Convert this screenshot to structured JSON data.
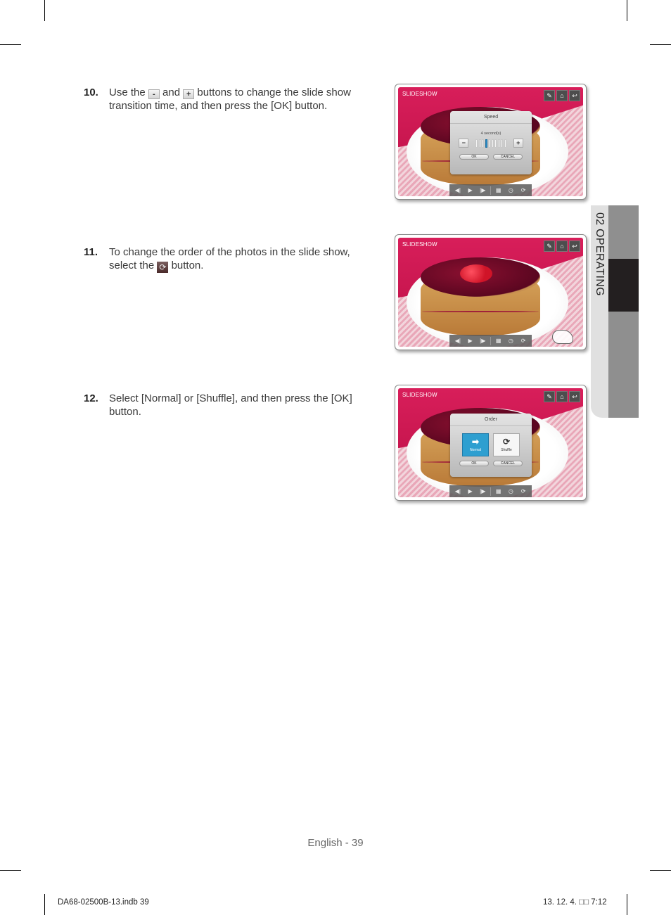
{
  "steps": [
    {
      "number": "10.",
      "text_before_minus": "Use the",
      "minus_symbol": "-",
      "text_between": "and",
      "plus_symbol": "+",
      "text_after_plus": "buttons to change the slide show transition time, and then press the [OK] button."
    },
    {
      "number": "11.",
      "text_before_icon": "To change the order of the photos in the slide show, select the",
      "icon_symbol": "⟳",
      "text_after_icon": "button."
    },
    {
      "number": "12.",
      "text": "Select [Normal] or [Shuffle], and then press the [OK] button."
    }
  ],
  "screens": {
    "common": {
      "mode_label": "SLIDESHOW",
      "top_buttons": [
        {
          "name": "edit",
          "symbol": "✎"
        },
        {
          "name": "home",
          "symbol": "⌂"
        },
        {
          "name": "back",
          "symbol": "↩"
        }
      ],
      "bottom_controls": [
        {
          "name": "previous",
          "symbol": "◀|"
        },
        {
          "name": "play",
          "symbol": "▶"
        },
        {
          "name": "next",
          "symbol": "|▶"
        },
        {
          "name": "grid",
          "symbol": "▦"
        },
        {
          "name": "speed",
          "symbol": "◷"
        },
        {
          "name": "order",
          "symbol": "⟳"
        }
      ]
    },
    "speed_dialog": {
      "title": "Speed",
      "value_label": "4 second(s)",
      "minus": "−",
      "plus": "+",
      "slider_value": 4,
      "slider_max": 10,
      "ok": "OK",
      "cancel": "CANCEL"
    },
    "order_dialog": {
      "title": "Order",
      "options": [
        {
          "label": "Normal",
          "symbol": "➡",
          "selected": true
        },
        {
          "label": "Shuffle",
          "symbol": "⟳",
          "selected": false
        }
      ],
      "ok": "OK",
      "cancel": "CANCEL"
    }
  },
  "side_tab": {
    "label": "02  OPERATING"
  },
  "footer": {
    "page_label": "English - 39",
    "file_info": "DA68-02500B-13.indb   39",
    "print_stamp": "13. 12. 4.   □□ 7:12"
  }
}
